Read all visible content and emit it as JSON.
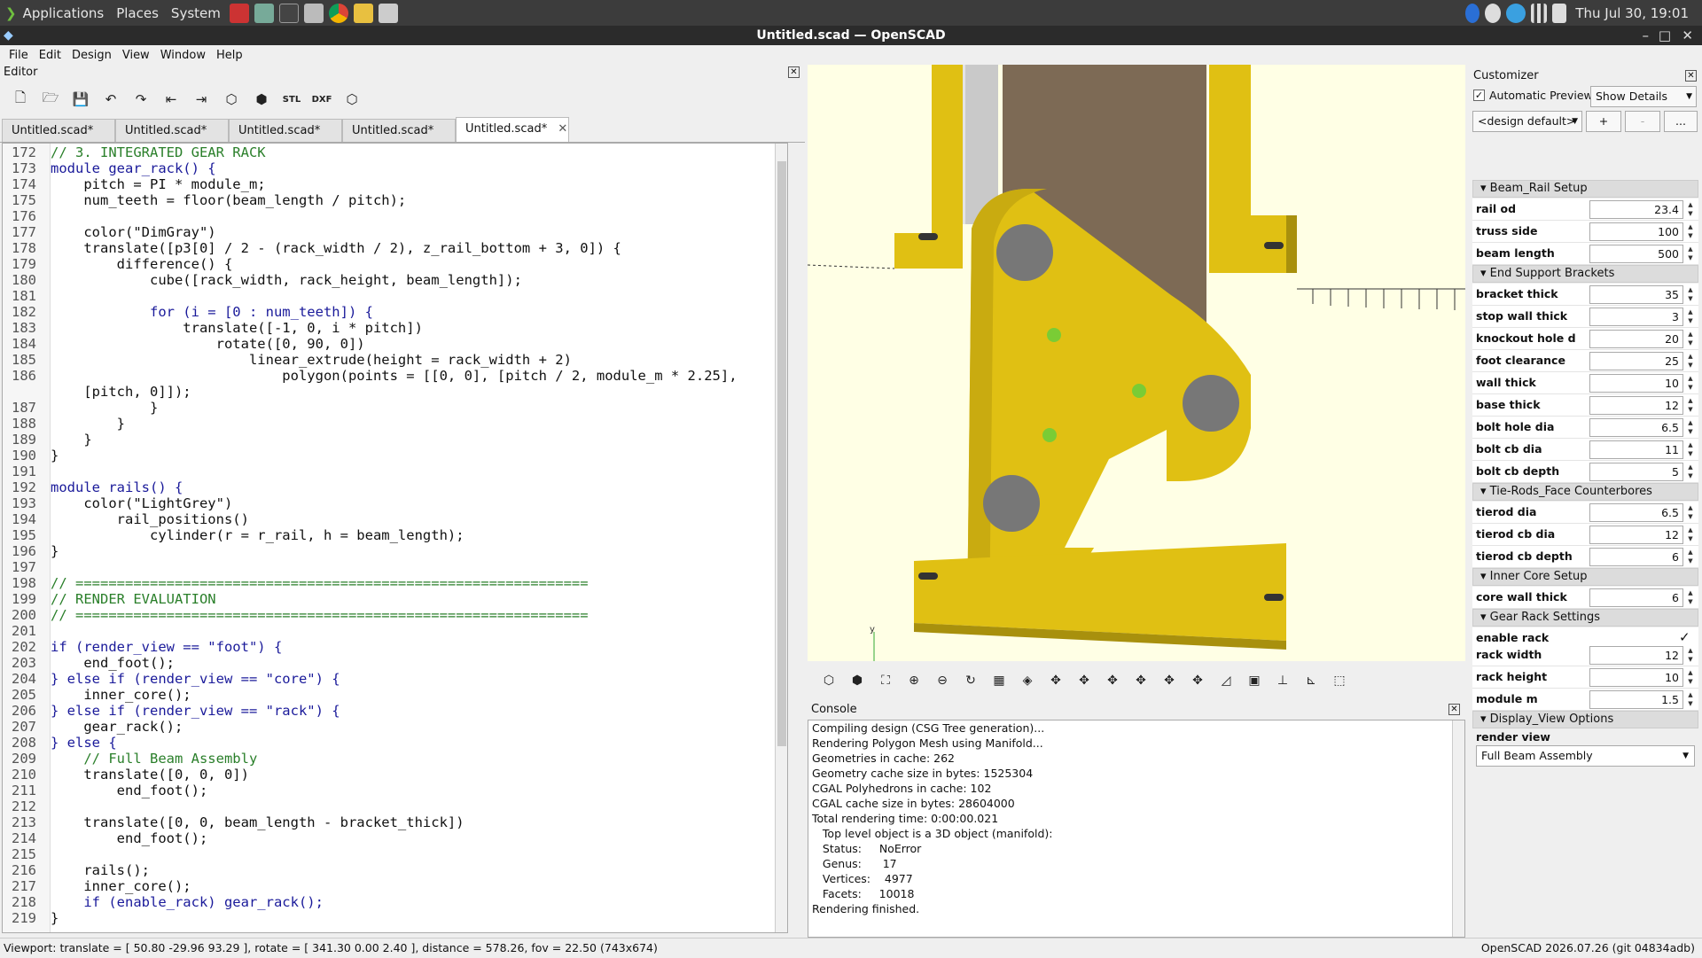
{
  "panel": {
    "menus": [
      "Applications",
      "Places",
      "System"
    ],
    "clock": "Thu Jul 30, 19:01"
  },
  "window": {
    "title": "Untitled.scad — OpenSCAD"
  },
  "menubar": [
    "File",
    "Edit",
    "Design",
    "View",
    "Window",
    "Help"
  ],
  "editor": {
    "title": "Editor",
    "tabs": [
      "Untitled.scad*",
      "Untitled.scad*",
      "Untitled.scad*",
      "Untitled.scad*",
      "Untitled.scad*"
    ],
    "lines": [
      {
        "n": "172",
        "t": "// 3. INTEGRATED GEAR RACK"
      },
      {
        "n": "173",
        "t": "module gear_rack() {"
      },
      {
        "n": "174",
        "t": "    pitch = PI * module_m;"
      },
      {
        "n": "175",
        "t": "    num_teeth = floor(beam_length / pitch);"
      },
      {
        "n": "176",
        "t": ""
      },
      {
        "n": "177",
        "t": "    color(\"DimGray\")"
      },
      {
        "n": "178",
        "t": "    translate([p3[0] / 2 - (rack_width / 2), z_rail_bottom + 3, 0]) {"
      },
      {
        "n": "179",
        "t": "        difference() {"
      },
      {
        "n": "180",
        "t": "            cube([rack_width, rack_height, beam_length]);"
      },
      {
        "n": "181",
        "t": ""
      },
      {
        "n": "182",
        "t": "            for (i = [0 : num_teeth]) {"
      },
      {
        "n": "183",
        "t": "                translate([-1, 0, i * pitch])"
      },
      {
        "n": "184",
        "t": "                    rotate([0, 90, 0])"
      },
      {
        "n": "185",
        "t": "                        linear_extrude(height = rack_width + 2)"
      },
      {
        "n": "186",
        "t": "                            polygon(points = [[0, 0], [pitch / 2, module_m * 2.25],"
      },
      {
        "n": "",
        "t": "    [pitch, 0]]);"
      },
      {
        "n": "187",
        "t": "            }"
      },
      {
        "n": "188",
        "t": "        }"
      },
      {
        "n": "189",
        "t": "    }"
      },
      {
        "n": "190",
        "t": "}"
      },
      {
        "n": "191",
        "t": ""
      },
      {
        "n": "192",
        "t": "module rails() {"
      },
      {
        "n": "193",
        "t": "    color(\"LightGrey\")"
      },
      {
        "n": "194",
        "t": "        rail_positions()"
      },
      {
        "n": "195",
        "t": "            cylinder(r = r_rail, h = beam_length);"
      },
      {
        "n": "196",
        "t": "}"
      },
      {
        "n": "197",
        "t": ""
      },
      {
        "n": "198",
        "t": "// =============================================================="
      },
      {
        "n": "199",
        "t": "// RENDER EVALUATION"
      },
      {
        "n": "200",
        "t": "// =============================================================="
      },
      {
        "n": "201",
        "t": ""
      },
      {
        "n": "202",
        "t": "if (render_view == \"foot\") {"
      },
      {
        "n": "203",
        "t": "    end_foot();"
      },
      {
        "n": "204",
        "t": "} else if (render_view == \"core\") {"
      },
      {
        "n": "205",
        "t": "    inner_core();"
      },
      {
        "n": "206",
        "t": "} else if (render_view == \"rack\") {"
      },
      {
        "n": "207",
        "t": "    gear_rack();"
      },
      {
        "n": "208",
        "t": "} else {"
      },
      {
        "n": "209",
        "t": "    // Full Beam Assembly"
      },
      {
        "n": "210",
        "t": "    translate([0, 0, 0])"
      },
      {
        "n": "211",
        "t": "        end_foot();"
      },
      {
        "n": "212",
        "t": ""
      },
      {
        "n": "213",
        "t": "    translate([0, 0, beam_length - bracket_thick])"
      },
      {
        "n": "214",
        "t": "        end_foot();"
      },
      {
        "n": "215",
        "t": ""
      },
      {
        "n": "216",
        "t": "    rails();"
      },
      {
        "n": "217",
        "t": "    inner_core();"
      },
      {
        "n": "218",
        "t": "    if (enable_rack) gear_rack();"
      },
      {
        "n": "219",
        "t": "}"
      }
    ]
  },
  "console": {
    "title": "Console",
    "lines": [
      "Compiling design (CSG Tree generation)...",
      "Rendering Polygon Mesh using Manifold...",
      "Geometries in cache: 262",
      "Geometry cache size in bytes: 1525304",
      "CGAL Polyhedrons in cache: 102",
      "CGAL cache size in bytes: 28604000",
      "Total rendering time: 0:00:00.021",
      "   Top level object is a 3D object (manifold):",
      "   Status:     NoError",
      "   Genus:      17",
      "   Vertices:    4977",
      "   Facets:     10018",
      "Rendering finished."
    ]
  },
  "customizer": {
    "title": "Customizer",
    "auto_preview": "Automatic Preview",
    "show_details": "Show Details",
    "preset": "<design default>",
    "add": "+",
    "remove": "-",
    "more": "...",
    "sections": [
      {
        "name": "Beam_Rail Setup",
        "params": [
          {
            "label": "rail od",
            "value": "23.4"
          },
          {
            "label": "truss side",
            "value": "100"
          },
          {
            "label": "beam length",
            "value": "500"
          }
        ]
      },
      {
        "name": "End Support Brackets",
        "params": [
          {
            "label": "bracket thick",
            "value": "35"
          },
          {
            "label": "stop wall thick",
            "value": "3"
          },
          {
            "label": "knockout hole d",
            "value": "20"
          },
          {
            "label": "foot clearance",
            "value": "25"
          },
          {
            "label": "wall thick",
            "value": "10"
          },
          {
            "label": "base thick",
            "value": "12"
          },
          {
            "label": "bolt hole dia",
            "value": "6.5"
          },
          {
            "label": "bolt cb dia",
            "value": "11"
          },
          {
            "label": "bolt cb depth",
            "value": "5"
          }
        ]
      },
      {
        "name": "Tie-Rods_Face Counterbores",
        "params": [
          {
            "label": "tierod dia",
            "value": "6.5"
          },
          {
            "label": "tierod cb dia",
            "value": "12"
          },
          {
            "label": "tierod cb depth",
            "value": "6"
          }
        ]
      },
      {
        "name": "Inner Core Setup",
        "params": [
          {
            "label": "core wall thick",
            "value": "6"
          }
        ]
      },
      {
        "name": "Gear Rack Settings",
        "params": [
          {
            "label": "enable rack",
            "value": "✓"
          },
          {
            "label": "rack width",
            "value": "12"
          },
          {
            "label": "rack height",
            "value": "10"
          },
          {
            "label": "module m",
            "value": "1.5"
          }
        ]
      }
    ],
    "display_section": "Display_View Options",
    "render_view_label": "render view",
    "render_view_value": "Full Beam Assembly"
  },
  "status": {
    "viewport": "Viewport: translate = [ 50.80 -29.96 93.29 ], rotate = [ 341.30 0.00 2.40 ], distance = 578.26, fov = 22.50 (743x674)",
    "version": "OpenSCAD 2026.07.26 (git 04834adb)"
  },
  "colors": {
    "model": "#e0c013",
    "model_dark": "#a8900d",
    "viewport_bg": "#ffffe5",
    "rail": "#c8c8c8",
    "core": "#7d6a55"
  }
}
